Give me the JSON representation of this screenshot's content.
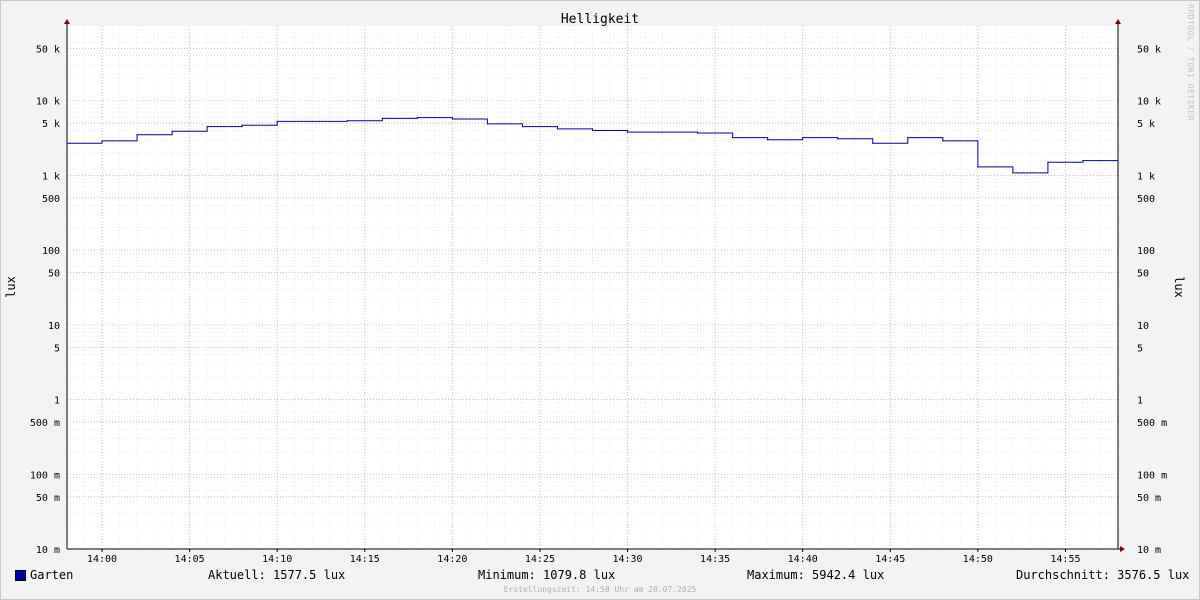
{
  "chart_data": {
    "type": "line",
    "title": "Helligkeit",
    "ylabel": "lux",
    "yscale": "log",
    "ylim": [
      0.01,
      100000
    ],
    "x_ticks": [
      "14:00",
      "14:05",
      "14:10",
      "14:15",
      "14:20",
      "14:25",
      "14:30",
      "14:35",
      "14:40",
      "14:45",
      "14:50",
      "14:55"
    ],
    "y_ticks": [
      {
        "value": 50000,
        "label": "50 k"
      },
      {
        "value": 10000,
        "label": "10 k"
      },
      {
        "value": 5000,
        "label": "5 k"
      },
      {
        "value": 1000,
        "label": "1 k"
      },
      {
        "value": 500,
        "label": "500"
      },
      {
        "value": 100,
        "label": "100"
      },
      {
        "value": 50,
        "label": "50"
      },
      {
        "value": 10,
        "label": "10"
      },
      {
        "value": 5,
        "label": "5"
      },
      {
        "value": 1,
        "label": "1"
      },
      {
        "value": 0.5,
        "label": "500 m"
      },
      {
        "value": 0.1,
        "label": "100 m"
      },
      {
        "value": 0.05,
        "label": "50 m"
      },
      {
        "value": 0.01,
        "label": "10 m"
      }
    ],
    "grid": true,
    "series": [
      {
        "name": "Garten",
        "color": "#0000a0",
        "points": [
          {
            "t": "13:58",
            "y": 2700
          },
          {
            "t": "14:00",
            "y": 2900
          },
          {
            "t": "14:02",
            "y": 3500
          },
          {
            "t": "14:04",
            "y": 3900
          },
          {
            "t": "14:06",
            "y": 4500
          },
          {
            "t": "14:08",
            "y": 4700
          },
          {
            "t": "14:10",
            "y": 5300
          },
          {
            "t": "14:12",
            "y": 5300
          },
          {
            "t": "14:14",
            "y": 5400
          },
          {
            "t": "14:16",
            "y": 5800
          },
          {
            "t": "14:18",
            "y": 5942.4
          },
          {
            "t": "14:20",
            "y": 5700
          },
          {
            "t": "14:22",
            "y": 4900
          },
          {
            "t": "14:24",
            "y": 4500
          },
          {
            "t": "14:26",
            "y": 4200
          },
          {
            "t": "14:28",
            "y": 4000
          },
          {
            "t": "14:30",
            "y": 3800
          },
          {
            "t": "14:32",
            "y": 3800
          },
          {
            "t": "14:34",
            "y": 3700
          },
          {
            "t": "14:36",
            "y": 3200
          },
          {
            "t": "14:38",
            "y": 3000
          },
          {
            "t": "14:40",
            "y": 3200
          },
          {
            "t": "14:42",
            "y": 3100
          },
          {
            "t": "14:44",
            "y": 2700
          },
          {
            "t": "14:46",
            "y": 3200
          },
          {
            "t": "14:48",
            "y": 2900
          },
          {
            "t": "14:50",
            "y": 1300
          },
          {
            "t": "14:52",
            "y": 1079.8
          },
          {
            "t": "14:54",
            "y": 1500
          },
          {
            "t": "14:56",
            "y": 1577.5
          }
        ],
        "end": "14:58"
      }
    ]
  },
  "legend": {
    "series_name": "Garten",
    "current": "Aktuell: 1577.5 lux",
    "minimum": "Minimum: 1079.8 lux",
    "maximum": "Maximum: 5942.4 lux",
    "average": "Durchschnitt: 3576.5 lux"
  },
  "footnote": "Erstellungszeit: 14:58 Uhr am 28.07.2025",
  "watermark": "RRDTOOL / TOBI OETIKER"
}
